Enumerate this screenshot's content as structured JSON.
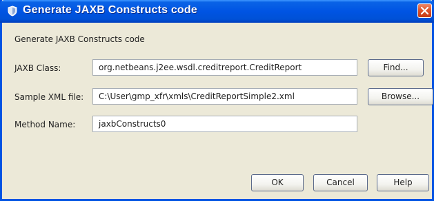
{
  "dialog": {
    "title": "Generate JAXB Constructs code",
    "subtitle": "Generate JAXB Constructs code"
  },
  "fields": {
    "jaxb_class": {
      "label": "JAXB Class:",
      "value": "org.netbeans.j2ee.wsdl.creditreport.CreditReport"
    },
    "sample_xml": {
      "label": "Sample XML file:",
      "value": "C:\\User\\gmp_xfr\\xmls\\CreditReportSimple2.xml"
    },
    "method_name": {
      "label": "Method Name:",
      "value": "jaxbConstructs0"
    }
  },
  "buttons": {
    "find": "Find...",
    "browse": "Browse...",
    "ok": "OK",
    "cancel": "Cancel",
    "help": "Help"
  },
  "icons": {
    "title": "shield-icon",
    "close": "close-icon"
  },
  "colors": {
    "titlebar": "#0054e3",
    "close_button": "#e0532a",
    "dialog_bg": "#ece9d8"
  }
}
